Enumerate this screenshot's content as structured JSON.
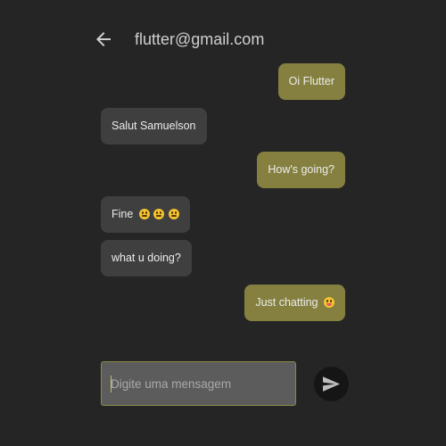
{
  "appbar": {
    "title": "flutter@gmail.com",
    "back_icon": "arrow-left-icon"
  },
  "messages": [
    {
      "from": "me",
      "text": "Oi Flutter",
      "emoji": []
    },
    {
      "from": "other",
      "text": "Salut Samuelson",
      "emoji": []
    },
    {
      "from": "me",
      "text": "How's going?",
      "emoji": []
    },
    {
      "from": "other",
      "text": "Fine",
      "emoji": [
        "grimacing-face",
        "grimacing-face",
        "grimacing-face"
      ]
    },
    {
      "from": "other",
      "text": "what u doing?",
      "emoji": []
    },
    {
      "from": "me",
      "text": "Just chatting",
      "emoji": [
        "face-savoring-food"
      ]
    }
  ],
  "composer": {
    "placeholder": "Digite uma mensagem",
    "value": "",
    "send_icon": "send-icon"
  },
  "colors": {
    "background": "#252525",
    "my_bubble": "#85803f",
    "their_bubble": "#3f3f3f",
    "input_background": "#5c5c5c",
    "send_button": "#151515"
  }
}
